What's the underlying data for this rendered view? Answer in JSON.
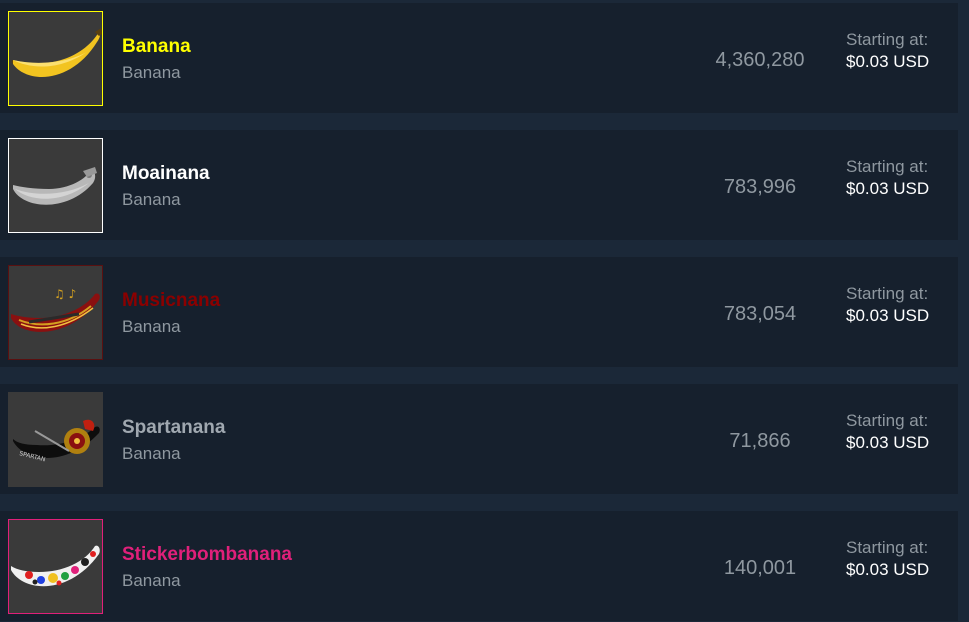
{
  "listings": [
    {
      "name": "Banana",
      "name_color": "#ffff00",
      "border_color": "#ffff00",
      "game": "Banana",
      "quantity": "4,360,280",
      "price_label": "Starting at:",
      "price": "$0.03 USD",
      "icon": "banana-yellow-icon"
    },
    {
      "name": "Moainana",
      "name_color": "#ffffff",
      "border_color": "#ffffff",
      "game": "Banana",
      "quantity": "783,996",
      "price_label": "Starting at:",
      "price": "$0.03 USD",
      "icon": "banana-stone-icon"
    },
    {
      "name": "Musicnana",
      "name_color": "#8b0000",
      "border_color": "#5a1010",
      "game": "Banana",
      "quantity": "783,054",
      "price_label": "Starting at:",
      "price": "$0.03 USD",
      "icon": "banana-music-icon"
    },
    {
      "name": "Spartanana",
      "name_color": "#a0a8b0",
      "border_color": "#3a3a3a",
      "game": "Banana",
      "quantity": "71,866",
      "price_label": "Starting at:",
      "price": "$0.03 USD",
      "icon": "banana-spartan-icon"
    },
    {
      "name": "Stickerbombanana",
      "name_color": "#e0207a",
      "border_color": "#e0207a",
      "game": "Banana",
      "quantity": "140,001",
      "price_label": "Starting at:",
      "price": "$0.03 USD",
      "icon": "banana-sticker-icon"
    }
  ]
}
